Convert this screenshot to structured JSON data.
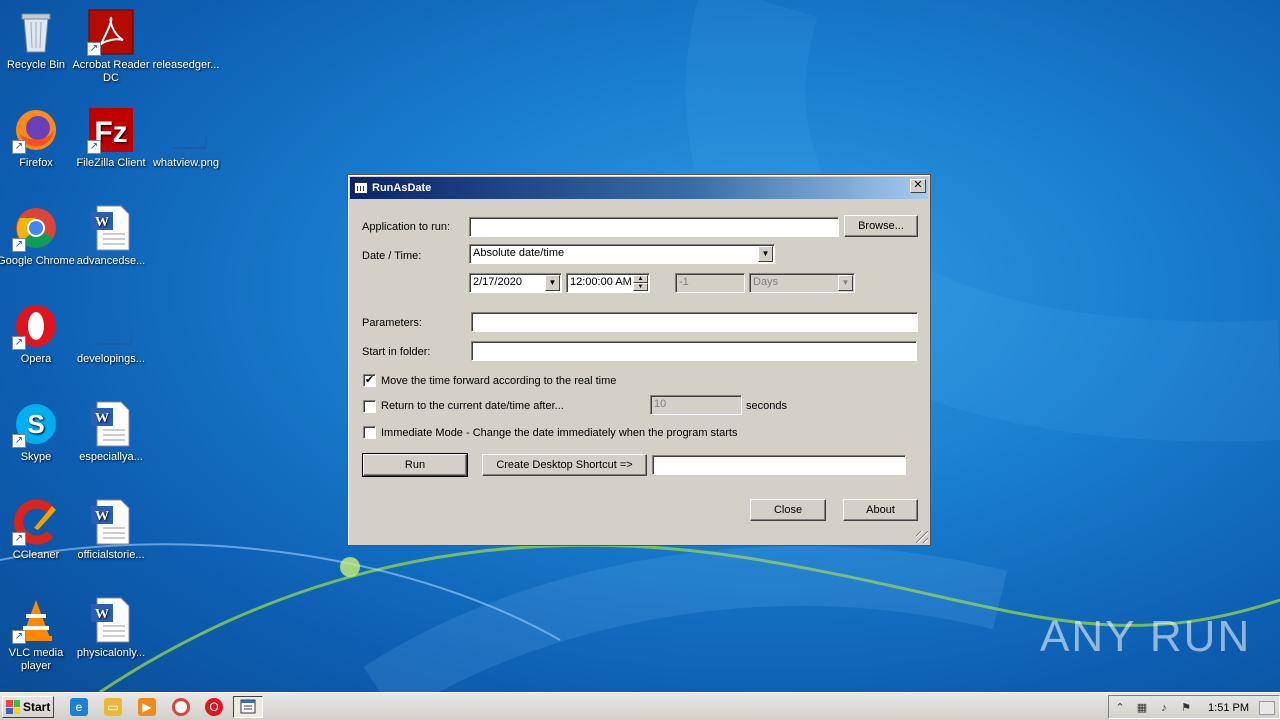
{
  "desktop": {
    "icons": [
      {
        "label": "Recycle Bin",
        "icon": "recycle-bin-icon"
      },
      {
        "label": "Acrobat Reader DC",
        "icon": "acrobat-icon"
      },
      {
        "label": "releasedger...",
        "icon": "file-icon"
      },
      {
        "label": "Firefox",
        "icon": "firefox-icon"
      },
      {
        "label": "FileZilla Client",
        "icon": "filezilla-icon"
      },
      {
        "label": "whatview.png",
        "icon": "file-icon"
      },
      {
        "label": "Google Chrome",
        "icon": "chrome-icon"
      },
      {
        "label": "advancedse...",
        "icon": "word-doc-icon"
      },
      {
        "label": "Opera",
        "icon": "opera-icon"
      },
      {
        "label": "developings...",
        "icon": "file-icon"
      },
      {
        "label": "Skype",
        "icon": "skype-icon"
      },
      {
        "label": "especiallya...",
        "icon": "word-doc-icon"
      },
      {
        "label": "CCleaner",
        "icon": "ccleaner-icon"
      },
      {
        "label": "officialstorie...",
        "icon": "word-doc-icon"
      },
      {
        "label": "VLC media player",
        "icon": "vlc-icon"
      },
      {
        "label": "physicalonly...",
        "icon": "word-doc-icon"
      }
    ],
    "watermark": "ANY RUN"
  },
  "dialog": {
    "title": "RunAsDate",
    "close_glyph": "✕",
    "app_label": "Application to run:",
    "app_value": "",
    "browse_label": "Browse...",
    "datetime_label": "Date / Time:",
    "datetime_mode": "Absolute date/time",
    "date_value": "2/17/2020",
    "time_value": "12:00:00 AM",
    "offset_value": "-1",
    "offset_unit": "Days",
    "params_label": "Parameters:",
    "params_value": "",
    "folder_label": "Start in folder:",
    "folder_value": "",
    "chk_forward_label": "Move the time forward according to the real time",
    "chk_forward_checked": true,
    "chk_return_label": "Return to the current date/time after...",
    "chk_return_checked": false,
    "return_seconds": "10",
    "seconds_label": "seconds",
    "chk_immediate_label": "Immediate Mode - Change the date immediately when the program starts",
    "chk_immediate_checked": false,
    "run_label": "Run",
    "shortcut_label": "Create Desktop Shortcut =>",
    "shortcut_value": "",
    "close_label": "Close",
    "about_label": "About"
  },
  "taskbar": {
    "start_label": "Start",
    "clock": "1:51 PM"
  }
}
